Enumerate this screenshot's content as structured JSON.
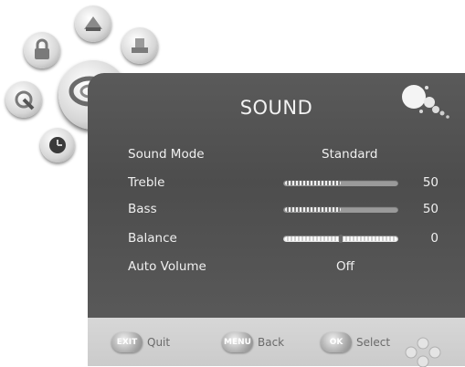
{
  "menu": {
    "title": "SOUND",
    "icons": [
      "picture-icon",
      "lock-icon",
      "setup-icon",
      "channel-icon",
      "sound-icon",
      "time-icon"
    ]
  },
  "settings": [
    {
      "label": "Sound Mode",
      "value": "Standard"
    },
    {
      "label": "Treble",
      "value": "50",
      "level": 0.5
    },
    {
      "label": "Bass",
      "value": "50",
      "level": 0.5
    },
    {
      "label": "Balance",
      "value": "0",
      "level": 0.5
    },
    {
      "label": "Auto Volume",
      "value": "Off"
    }
  ],
  "footer": {
    "quit_key": "EXIT",
    "quit_label": "Quit",
    "back_key": "MENU",
    "back_label": "Back",
    "select_key": "OK",
    "select_label": "Select"
  },
  "colors": {
    "panel": "#555555",
    "footer": "#d0d0d0",
    "text": "#f0f0f0"
  }
}
